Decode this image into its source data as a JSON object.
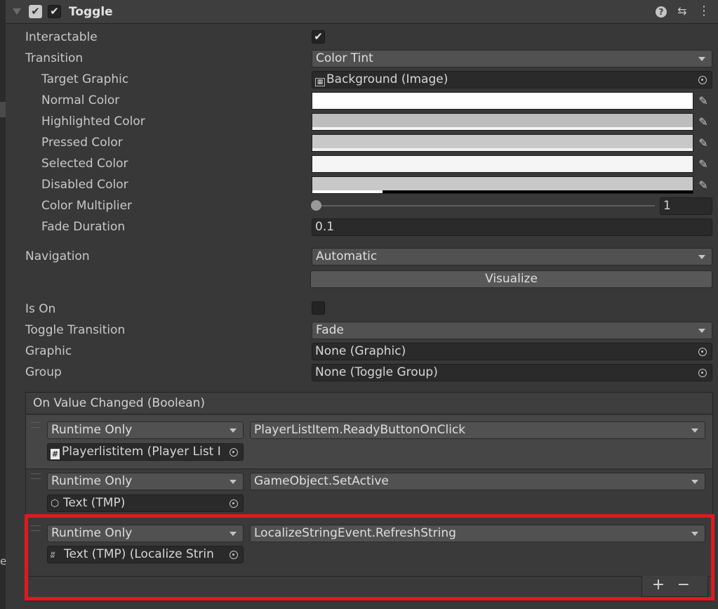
{
  "component": {
    "title": "Toggle",
    "enabled": true
  },
  "fields": {
    "interactable": {
      "label": "Interactable",
      "checked": true
    },
    "transition": {
      "label": "Transition",
      "value": "Color Tint"
    },
    "target_graphic": {
      "label": "Target Graphic",
      "value": "Background (Image)"
    },
    "normal_color": {
      "label": "Normal Color",
      "color": "#FFFFFF"
    },
    "highlighted_color": {
      "label": "Highlighted Color",
      "color": "#F5F5F5"
    },
    "pressed_color": {
      "label": "Pressed Color",
      "color": "#C8C8C8"
    },
    "selected_color": {
      "label": "Selected Color",
      "color": "#F5F5F5"
    },
    "disabled_color": {
      "label": "Disabled Color",
      "color": "#C8C8C8"
    },
    "color_multiplier": {
      "label": "Color Multiplier",
      "value": "1"
    },
    "fade_duration": {
      "label": "Fade Duration",
      "value": "0.1"
    },
    "navigation": {
      "label": "Navigation",
      "value": "Automatic"
    },
    "visualize": {
      "label": "Visualize"
    },
    "is_on": {
      "label": "Is On",
      "checked": false
    },
    "toggle_transition": {
      "label": "Toggle Transition",
      "value": "Fade"
    },
    "graphic": {
      "label": "Graphic",
      "value": "None (Graphic)"
    },
    "group": {
      "label": "Group",
      "value": "None (Toggle Group)"
    }
  },
  "event": {
    "header": "On Value Changed (Boolean)",
    "entries": [
      {
        "mode": "Runtime Only",
        "function": "PlayerListItem.ReadyButtonOnClick",
        "target": "Playerlistitem (Player List I",
        "target_icon": "script-icon"
      },
      {
        "mode": "Runtime Only",
        "function": "GameObject.SetActive",
        "target": "Text (TMP)",
        "target_icon": "gameobject-icon"
      },
      {
        "mode": "Runtime Only",
        "function": "LocalizeStringEvent.RefreshString",
        "target": "Text (TMP) (Localize Strin",
        "target_icon": "localize-icon"
      }
    ],
    "add": "+",
    "remove": "−"
  },
  "colors": {
    "highlight_border": "#E2181F",
    "panel_bg": "#383838"
  }
}
